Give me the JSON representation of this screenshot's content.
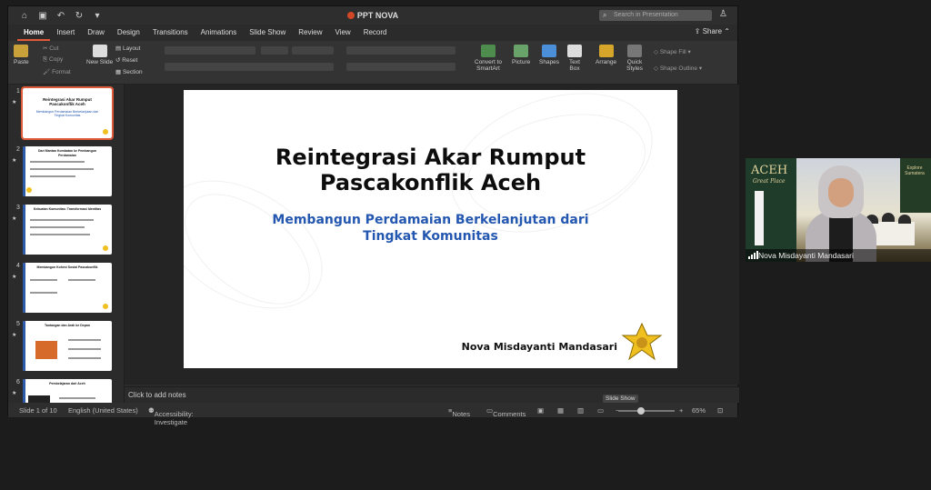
{
  "window": {
    "title": "PPT NOVA",
    "search_placeholder": "Search in Presentation"
  },
  "ribbon_tabs": [
    "Home",
    "Insert",
    "Draw",
    "Design",
    "Transitions",
    "Animations",
    "Slide Show",
    "Review",
    "View",
    "Record"
  ],
  "active_tab": "Home",
  "share_label": "Share",
  "ribbon": {
    "paste": "Paste",
    "cut": "Cut",
    "copy": "Copy",
    "format": "Format",
    "new_slide": "New Slide",
    "layout": "Layout",
    "reset": "Reset",
    "section": "Section",
    "convert": "Convert to SmartArt",
    "picture": "Picture",
    "shapes": "Shapes",
    "text_box": "Text Box",
    "arrange": "Arrange",
    "quick_styles": "Quick Styles",
    "shape_fill": "Shape Fill",
    "shape_outline": "Shape Outline"
  },
  "thumbnails": [
    {
      "num": "1",
      "title": "Reintegrasi Akar Rumput Pascakonflik Aceh",
      "subtitle": "Membangun Perdamaian Berkelanjutan dari Tingkat Komunitas"
    },
    {
      "num": "2",
      "title": "Dari Mantan Kombatan ke Pembangun Perdamaian"
    },
    {
      "num": "3",
      "title": "Kekuatan Komunitas: Transformasi Identitas"
    },
    {
      "num": "4",
      "title": "Membangun Kohesi Sosial Pascakonflik"
    },
    {
      "num": "5",
      "title": "Tantangan dan Arah ke Depan"
    },
    {
      "num": "6",
      "title": "Pembelajaran dari Aceh"
    }
  ],
  "slide": {
    "title_line1": "Reintegrasi Akar Rumput",
    "title_line2": "Pascakonflik Aceh",
    "subtitle_line1": "Membangun Perdamaian Berkelanjutan dari",
    "subtitle_line2": "Tingkat Komunitas",
    "author": "Nova Misdayanti Mandasari"
  },
  "notes_placeholder": "Click to add notes",
  "status": {
    "slide_info": "Slide 1 of 10",
    "language": "English (United States)",
    "accessibility": "Accessibility: Investigate",
    "notes": "Notes",
    "comments": "Comments",
    "tooltip": "Slide Show",
    "zoom": "65%"
  },
  "video": {
    "participant_name": "Nova Misdayanti Mandasari",
    "bg_text": "ACEH",
    "bg_subtext": "Great Place",
    "bg_right_text": "Explore Sumatera"
  },
  "colors": {
    "accent": "#e05a3a",
    "subtitle_blue": "#2457b0",
    "logo_yellow": "#f0c020"
  }
}
